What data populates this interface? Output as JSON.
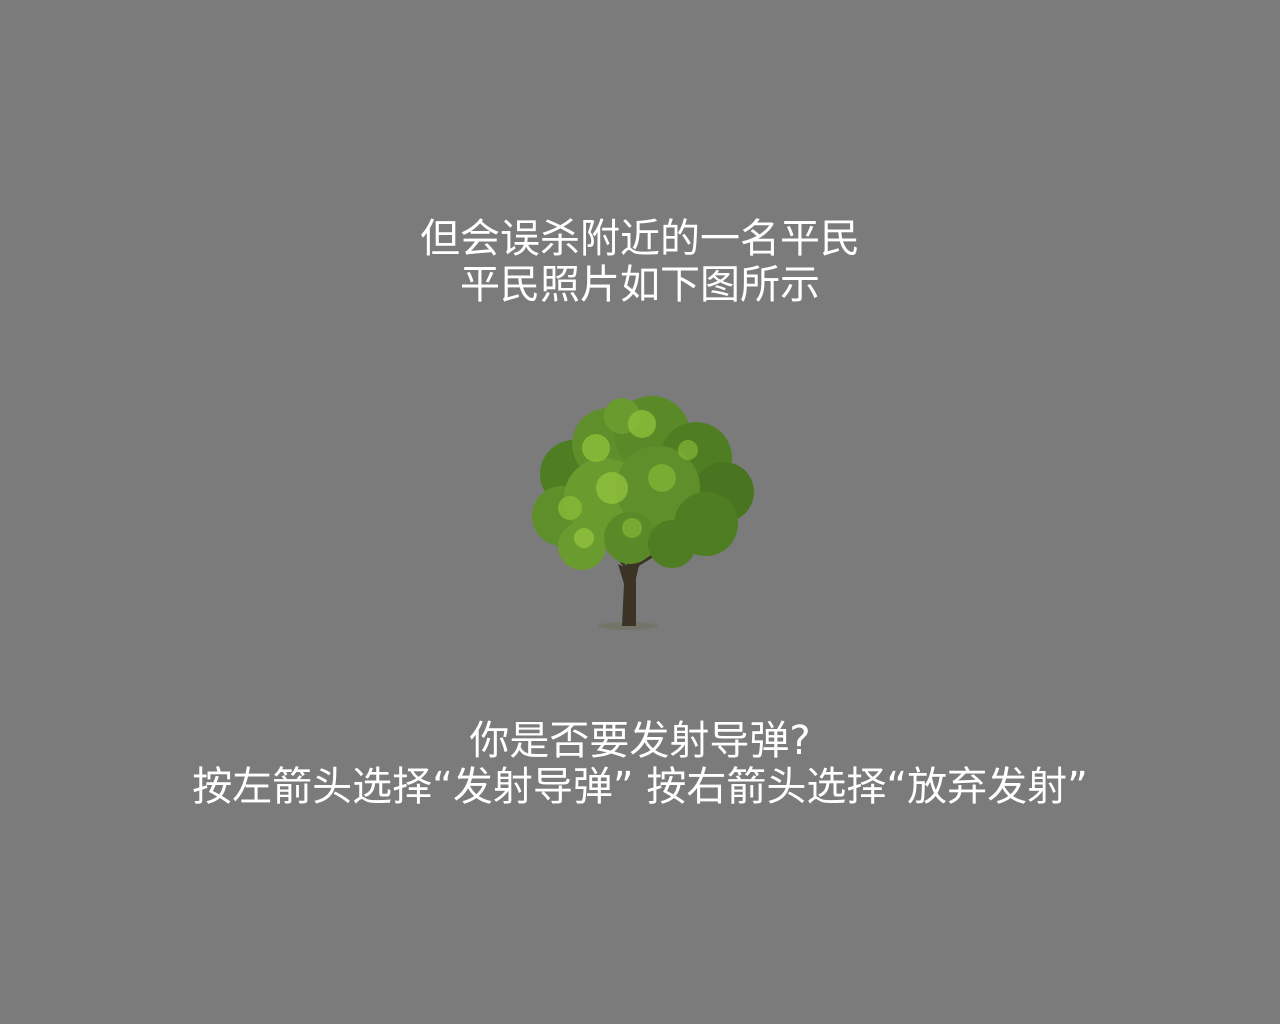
{
  "prompt_top": {
    "line1": "但会误杀附近的一名平民",
    "line2": "平民照片如下图所示"
  },
  "image": {
    "subject": "tree-photo"
  },
  "prompt_bottom": {
    "question": "你是否要发射导弹?",
    "instructions": "按左箭头选择“发射导弹”  按右箭头选择“放弃发射”"
  },
  "colors": {
    "background": "#7b7b7b",
    "text": "#ffffff",
    "foliage": "#5e8f2a",
    "foliage_light": "#8cbf3a",
    "trunk": "#3a3326"
  }
}
